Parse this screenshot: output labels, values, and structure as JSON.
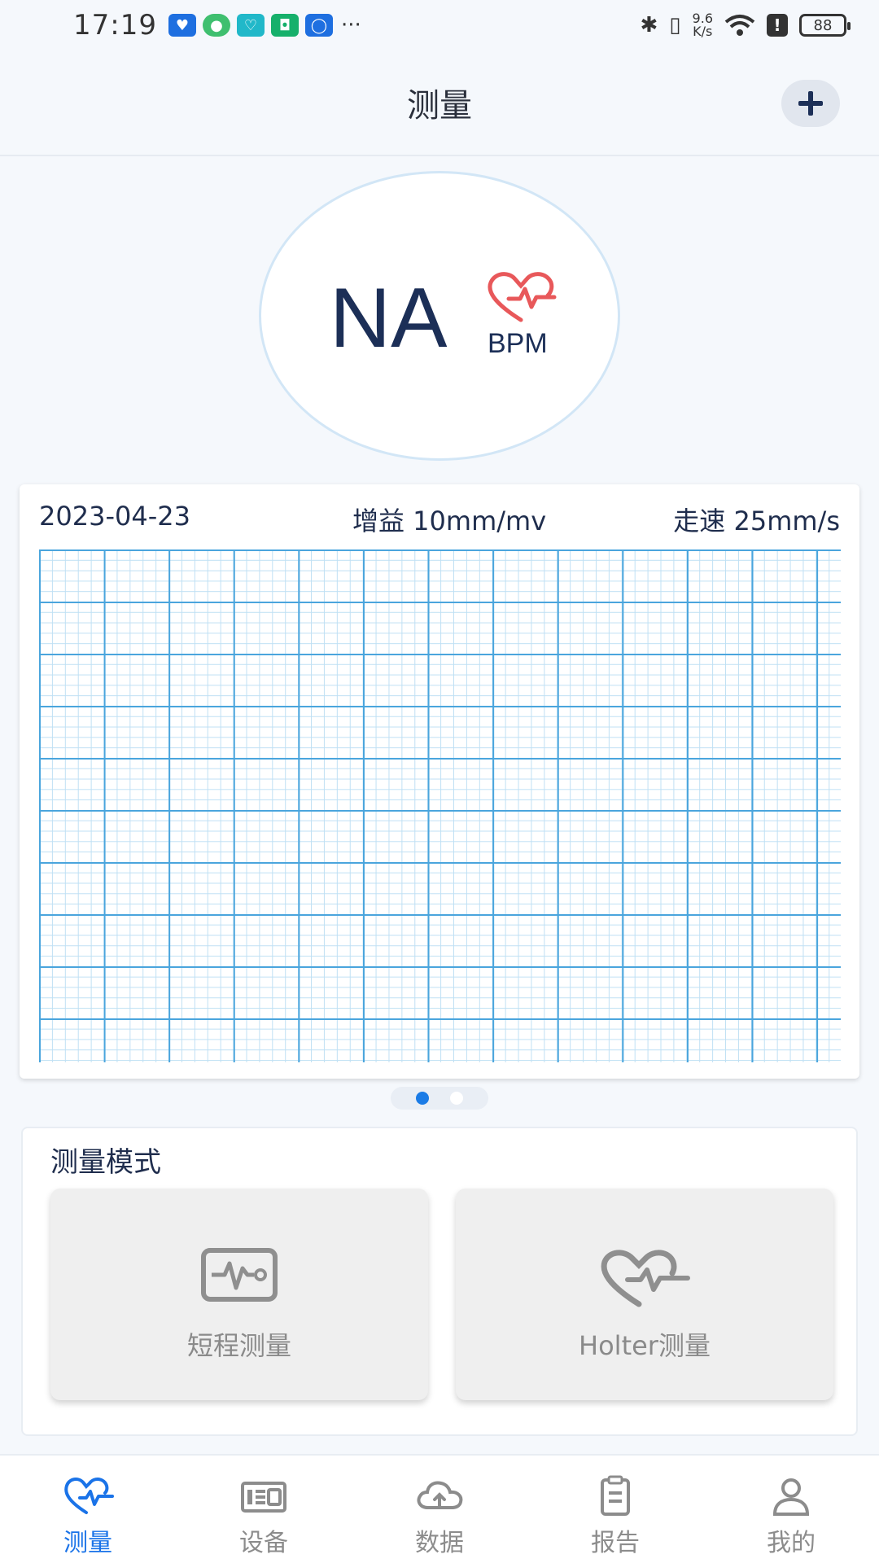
{
  "status_bar": {
    "time": "17:19",
    "more": "···",
    "net_speed_value": "9.6",
    "net_speed_unit": "K/s",
    "battery": "88",
    "notification_icons": [
      "shield-icon",
      "android-icon",
      "health-icon",
      "xiaomi-icon",
      "bulb-icon"
    ]
  },
  "header": {
    "title": "测量"
  },
  "heart_rate": {
    "value": "NA",
    "unit": "BPM"
  },
  "ecg": {
    "date": "2023-04-23",
    "gain": "增益 10mm/mv",
    "speed": "走速 25mm/s",
    "page_count": 2,
    "current_page": 1
  },
  "mode_section": {
    "title": "测量模式",
    "modes": [
      {
        "label": "短程测量",
        "icon": "ecg-monitor-icon"
      },
      {
        "label": "Holter测量",
        "icon": "heart-pulse-icon"
      }
    ]
  },
  "bottom_nav": {
    "items": [
      {
        "label": "测量",
        "icon": "heart-pulse-icon",
        "active": true
      },
      {
        "label": "设备",
        "icon": "device-icon",
        "active": false
      },
      {
        "label": "数据",
        "icon": "cloud-upload-icon",
        "active": false
      },
      {
        "label": "报告",
        "icon": "clipboard-icon",
        "active": false
      },
      {
        "label": "我的",
        "icon": "user-icon",
        "active": false
      }
    ]
  },
  "colors": {
    "accent": "#1a73e8",
    "heart": "#e8585a",
    "grid_major": "#4aa5dd",
    "grid_minor": "#bfe0f4",
    "text_primary": "#1c2f57"
  }
}
